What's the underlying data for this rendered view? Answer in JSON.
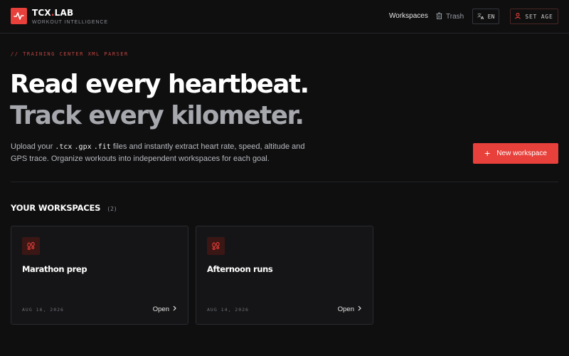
{
  "header": {
    "brand_name": "TCX",
    "brand_dot": ".",
    "brand_suffix": "LAB",
    "brand_tagline": "WORKOUT INTELLIGENCE",
    "nav": {
      "workspaces_label": "Workspaces",
      "trash_label": "Trash",
      "language_label": "EN",
      "set_age_label": "SET AGE"
    },
    "icons": {
      "logo": "pulse-icon",
      "trash": "trash-icon",
      "language": "translate-icon",
      "set_age": "user-icon"
    }
  },
  "hero": {
    "eyebrow": "// TRAINING CENTER XML PARSER",
    "headline_line1": "Read every heartbeat.",
    "headline_line2": "Track every kilometer.",
    "lead_prefix": "Upload your ",
    "formats": [
      ".tcx",
      ".gpx",
      ".fit"
    ],
    "lead_suffix": " files and instantly extract heart rate, speed, altitude and GPS trace. Organize workouts into independent workspaces for each goal.",
    "new_workspace_label": "New workspace",
    "new_workspace_icon": "plus-icon"
  },
  "workspaces": {
    "title": "YOUR WORKSPACES",
    "count_label": "(2)",
    "items": [
      {
        "name": "Marathon prep",
        "date": "AUG 16, 2026",
        "open_label": "Open",
        "icon": "footprints-icon"
      },
      {
        "name": "Afternoon runs",
        "date": "AUG 14, 2026",
        "open_label": "Open",
        "icon": "footprints-icon"
      }
    ]
  },
  "colors": {
    "accent": "#e8403a",
    "background": "#0f0f10",
    "card": "#151517",
    "muted_text": "#8d8f96"
  }
}
